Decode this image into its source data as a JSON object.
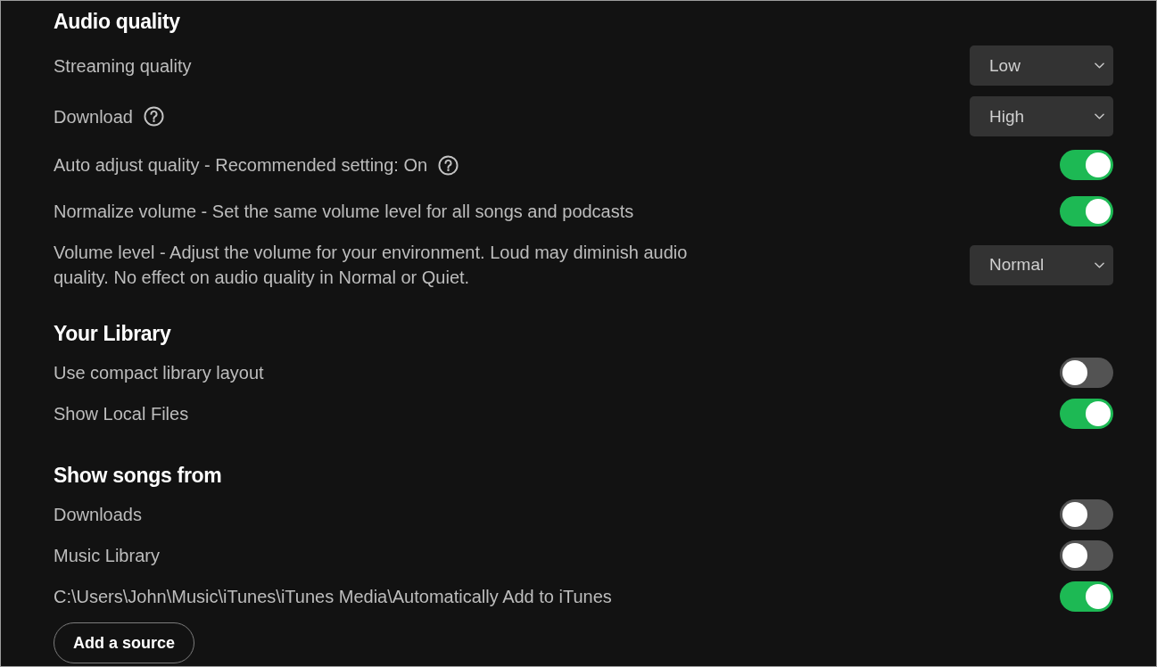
{
  "sections": [
    {
      "title": "Audio quality",
      "rows": [
        {
          "kind": "select",
          "label": "Streaming quality",
          "help": false,
          "value": "Low"
        },
        {
          "kind": "select",
          "label": "Download",
          "help": true,
          "value": "High"
        },
        {
          "kind": "toggle",
          "label": "Auto adjust quality - Recommended setting: On",
          "help": true,
          "on": true
        },
        {
          "kind": "toggle",
          "label": "Normalize volume - Set the same volume level for all songs and podcasts",
          "help": false,
          "on": true
        },
        {
          "kind": "select",
          "label": "Volume level - Adjust the volume for your environment. Loud may diminish audio quality. No effect on audio quality in Normal or Quiet.",
          "help": false,
          "value": "Normal"
        }
      ]
    },
    {
      "title": "Your Library",
      "rows": [
        {
          "kind": "toggle",
          "label": "Use compact library layout",
          "help": false,
          "on": false
        },
        {
          "kind": "toggle",
          "label": "Show Local Files",
          "help": false,
          "on": true
        }
      ]
    },
    {
      "title": "Show songs from",
      "rows": [
        {
          "kind": "toggle",
          "label": "Downloads",
          "help": false,
          "on": false
        },
        {
          "kind": "toggle",
          "label": "Music Library",
          "help": false,
          "on": false
        },
        {
          "kind": "toggle",
          "label": "C:\\Users\\John\\Music\\iTunes\\iTunes Media\\Automatically Add to iTunes",
          "help": false,
          "on": true
        }
      ]
    }
  ],
  "add_source_button": {
    "label": "Add a source"
  }
}
